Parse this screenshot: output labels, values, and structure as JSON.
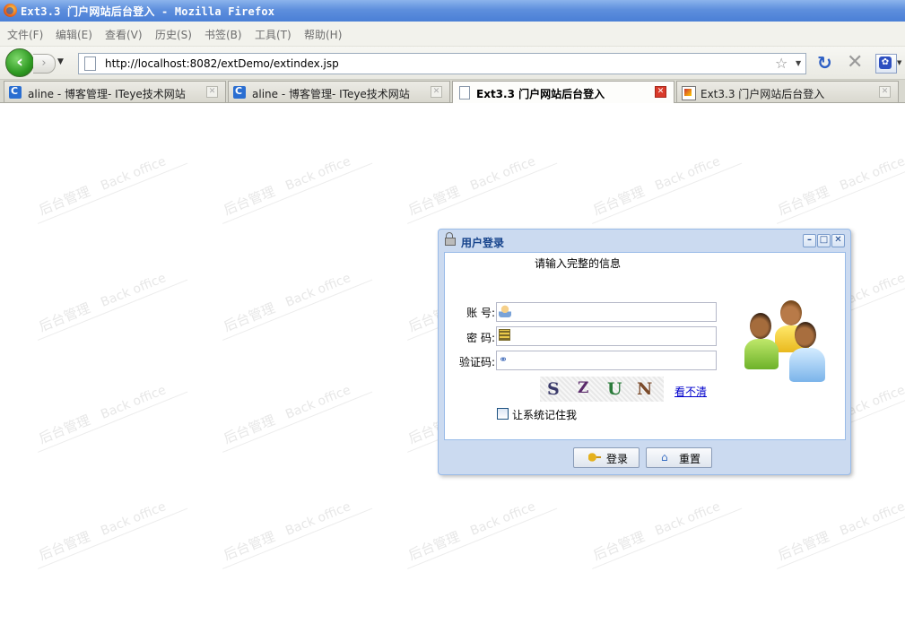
{
  "window": {
    "title": "Ext3.3 门户网站后台登入 - Mozilla Firefox"
  },
  "menu": [
    "文件(F)",
    "编辑(E)",
    "查看(V)",
    "历史(S)",
    "书签(B)",
    "工具(T)",
    "帮助(H)"
  ],
  "navbar": {
    "url": "http://localhost:8082/extDemo/extindex.jsp",
    "search_engine_icon": "baidu-paw-icon"
  },
  "tabs": [
    {
      "label": "aline - 博客管理- ITeye技术网站",
      "favicon": "iteye-icon",
      "active": false
    },
    {
      "label": "aline - 博客管理- ITeye技术网站",
      "favicon": "iteye-icon",
      "active": false
    },
    {
      "label": "Ext3.3 门户网站后台登入",
      "favicon": "page-icon",
      "active": true
    },
    {
      "label": "Ext3.3 门户网站后台登入",
      "favicon": "image-icon",
      "active": false
    }
  ],
  "watermark": {
    "cn": "后台管理",
    "en": "Back office"
  },
  "login": {
    "title": "用户登录",
    "hint": "请输入完整的信息",
    "account_label": "账 号:",
    "password_label": "密 码:",
    "captcha_label": "验证码:",
    "account_value": "",
    "password_value": "",
    "captcha_value": "",
    "captcha_text": "S Z U N",
    "captcha_chars": [
      "S",
      "Z",
      "U",
      "N"
    ],
    "cant_see_link": "看不清",
    "remember_label": "让系统记住我",
    "remember_checked": false,
    "login_button": "登录",
    "reset_button": "重置"
  }
}
